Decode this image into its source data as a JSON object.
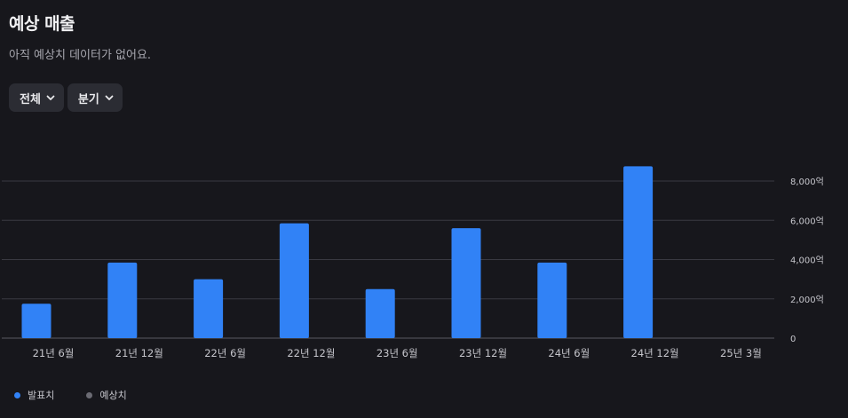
{
  "header": {
    "title": "예상 매출",
    "subtitle": "아직 예상치 데이터가 없어요."
  },
  "filters": [
    {
      "label": "전체"
    },
    {
      "label": "분기"
    }
  ],
  "colors": {
    "actual": "#3182f6",
    "forecast": "#6b6b73"
  },
  "legend": {
    "actual_label": "발표치",
    "forecast_label": "예상치"
  },
  "chart_data": {
    "type": "bar",
    "categories": [
      "21년 6월",
      "21년 12월",
      "22년 6월",
      "22년 12월",
      "23년 6월",
      "23년 12월",
      "24년 6월",
      "24년 12월",
      "25년 3월"
    ],
    "series": [
      {
        "name": "발표치",
        "values": [
          1750,
          3850,
          3000,
          5850,
          2500,
          5600,
          3850,
          8750,
          null
        ]
      },
      {
        "name": "예상치",
        "values": [
          null,
          null,
          null,
          null,
          null,
          null,
          null,
          null,
          null
        ]
      }
    ],
    "ylim": [
      0,
      8000
    ],
    "yticks": [
      0,
      2000,
      4000,
      6000,
      8000
    ],
    "ytick_labels": [
      "0",
      "2,000억",
      "4,000억",
      "6,000억",
      "8,000억"
    ],
    "y_axis_position": "right",
    "grid": true,
    "legend_position": "bottom-left"
  }
}
